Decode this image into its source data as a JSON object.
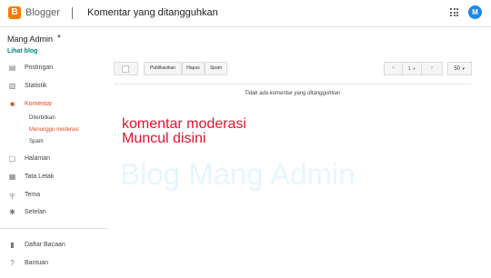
{
  "header": {
    "brand": "Blogger",
    "title": "Komentar yang ditangguhkan",
    "avatar_initial": "M"
  },
  "sidebar": {
    "blog_name": "Mang Admin",
    "view_blog": "Lihat blog",
    "items": [
      {
        "label": "Postingan",
        "icon": "posts-icon"
      },
      {
        "label": "Statistik",
        "icon": "stats-icon"
      },
      {
        "label": "Komentar",
        "icon": "comments-icon"
      },
      {
        "label": "Halaman",
        "icon": "pages-icon"
      },
      {
        "label": "Tata Letak",
        "icon": "layout-icon"
      },
      {
        "label": "Tema",
        "icon": "theme-icon"
      },
      {
        "label": "Setelan",
        "icon": "settings-icon"
      },
      {
        "label": "Daftar Bacaan",
        "icon": "bookmark-icon"
      },
      {
        "label": "Bantuan",
        "icon": "help-icon"
      }
    ],
    "comment_sub": [
      "Diterbitkan",
      "Menunggu moderasi",
      "Spam"
    ]
  },
  "toolbar": {
    "publish": "Publikasikan",
    "delete": "Hapus",
    "spam": "Spam",
    "page": "1",
    "per_page": "50"
  },
  "main": {
    "empty_message": "Tidak ada komentar yang ditangguhkan",
    "note_line1": "komentar moderasi",
    "note_line2": "Muncul disini",
    "watermark": "Blog Mang Admin"
  },
  "colors": {
    "accent": "#e64a19",
    "brand": "#f57d00",
    "link": "#00897b",
    "note": "#e0142d"
  }
}
